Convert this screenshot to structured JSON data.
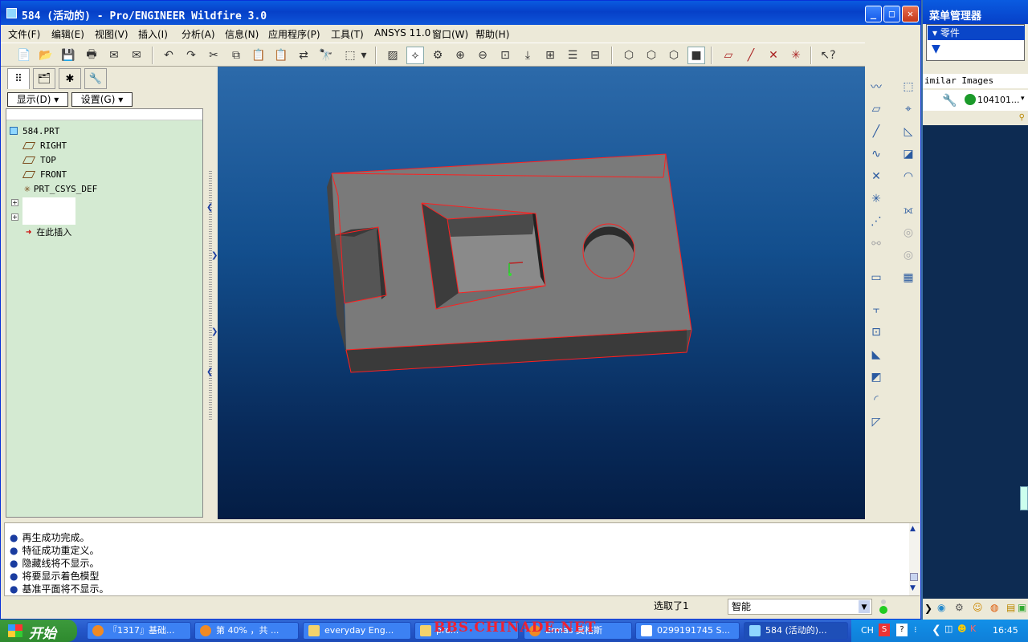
{
  "window": {
    "title": "584 (活动的) - Pro/ENGINEER Wildfire 3.0",
    "minimize": "_",
    "maximize": "□",
    "close": "✕"
  },
  "menu": [
    "文件(F)",
    "编辑(E)",
    "视图(V)",
    "插入(I)",
    "分析(A)",
    "信息(N)",
    "应用程序(P)",
    "工具(T)",
    "ANSYS 11.0",
    "窗口(W)",
    "帮助(H)"
  ],
  "left_panel": {
    "show_button": "显示(D)",
    "settings_button": "设置(G)",
    "tree": {
      "root": "584.PRT",
      "items": [
        "RIGHT",
        "TOP",
        "FRONT",
        "PRT_CSYS_DEF"
      ],
      "insert_here": "在此插入"
    }
  },
  "messages": [
    "再生成功完成。",
    "特征成功重定义。",
    "隐藏线将不显示。",
    "将要显示着色模型",
    "基准平面将不显示。"
  ],
  "status": {
    "selected": "选取了1",
    "filter": "智能"
  },
  "menu_manager": {
    "title": "菜单管理器",
    "item": "零件",
    "similar_images": "imilar Images",
    "result": "104101..."
  },
  "taskbar": {
    "start": "开始",
    "tasks": [
      "『1317』基础...",
      "第 40% ，共 ...",
      "everyday Eng...",
      "pro...",
      "Ermas 莫格斯",
      "0299191745 S...",
      "584 (活动的)..."
    ],
    "watermark": "BBS.CHINADE.NET",
    "lang": "CH",
    "clock": "16:45"
  },
  "colors": {
    "titlebar": "#0a5be0",
    "tree_bg": "#d4ead2",
    "viewport_top": "#2c6aaa",
    "viewport_bottom": "#041d44",
    "edge": "#ff2020"
  }
}
